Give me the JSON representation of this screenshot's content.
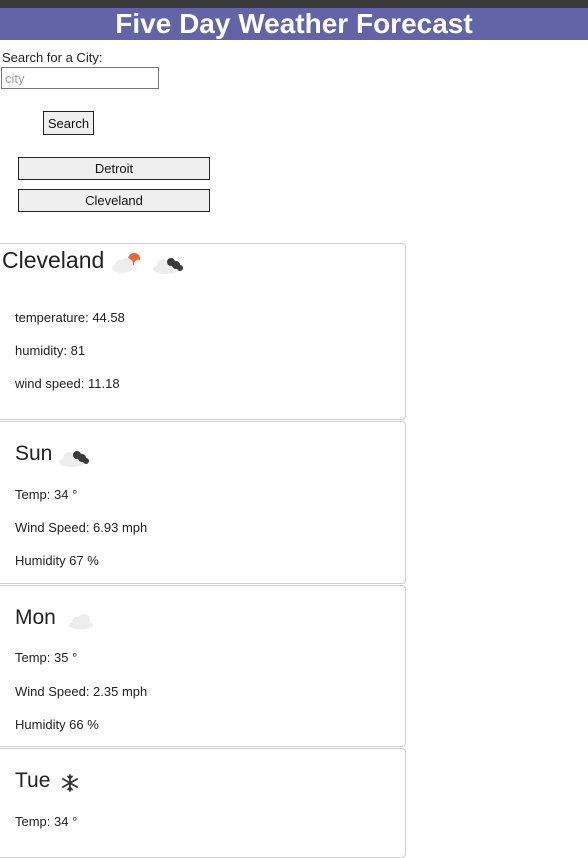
{
  "header": {
    "title": "Five Day Weather Forecast"
  },
  "search": {
    "label": "Search for a City:",
    "placeholder": "city",
    "value": "",
    "button_label": "Search"
  },
  "history": [
    {
      "label": "Detroit"
    },
    {
      "label": "Cleveland"
    }
  ],
  "current": {
    "city": "Cleveland",
    "icons": [
      "partly-cloudy-night-icon",
      "cloudy-rain-icon"
    ],
    "temperature": "temperature: 44.58",
    "humidity": "humidity: 81",
    "wind": "wind speed: 11.18"
  },
  "forecast": [
    {
      "day": "Sun",
      "icon": "cloudy-rain-icon",
      "temp": "Temp: 34 °",
      "wind": "Wind Speed: 6.93 mph",
      "humidity": "Humidity 67 %"
    },
    {
      "day": "Mon",
      "icon": "cloud-icon",
      "temp": "Temp: 35 °",
      "wind": "Wind Speed: 2.35 mph",
      "humidity": "Humidity 66 %"
    },
    {
      "day": "Tue",
      "icon": "snowflake-icon",
      "temp": "Temp: 34 °"
    }
  ]
}
